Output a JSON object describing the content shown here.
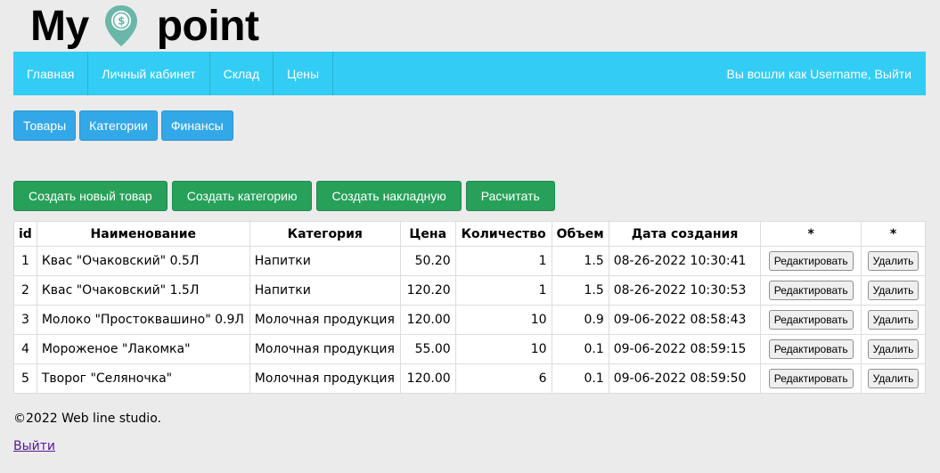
{
  "brand": {
    "word1": "My",
    "word2": "point",
    "pin_symbol": "$",
    "pin_color": "#6ab7a9",
    "icon": "map-pin-dollar-icon"
  },
  "nav": {
    "items": [
      {
        "label": "Главная"
      },
      {
        "label": "Личный кабинет"
      },
      {
        "label": "Склад"
      },
      {
        "label": "Цены"
      }
    ],
    "user_text": "Вы вошли как Username, Выйти"
  },
  "subnav": {
    "items": [
      {
        "label": "Товары"
      },
      {
        "label": "Категории"
      },
      {
        "label": "Финансы"
      }
    ]
  },
  "actions": {
    "create_product": "Создать новый товар",
    "create_category": "Создать категорию",
    "create_invoice": "Создать накладную",
    "calculate": "Расчитать"
  },
  "table": {
    "headers": [
      "id",
      "Наименование",
      "Категория",
      "Цена",
      "Количество",
      "Объем",
      "Дата создания",
      "*",
      "*"
    ],
    "edit_label": "Редактировать",
    "delete_label": "Удалить",
    "rows": [
      {
        "id": "1",
        "name": "Квас \"Очаковский\" 0.5Л",
        "category": "Напитки",
        "price": "50.20",
        "qty": "1",
        "volume": "1.5",
        "created": "08-26-2022 10:30:41"
      },
      {
        "id": "2",
        "name": "Квас \"Очаковский\" 1.5Л",
        "category": "Напитки",
        "price": "120.20",
        "qty": "1",
        "volume": "1.5",
        "created": "08-26-2022 10:30:53"
      },
      {
        "id": "3",
        "name": "Молоко \"Простоквашино\" 0.9Л",
        "category": "Молочная продукция",
        "price": "120.00",
        "qty": "10",
        "volume": "0.9",
        "created": "09-06-2022 08:58:43"
      },
      {
        "id": "4",
        "name": "Мороженое \"Лакомка\"",
        "category": "Молочная продукция",
        "price": "55.00",
        "qty": "10",
        "volume": "0.1",
        "created": "09-06-2022 08:59:15"
      },
      {
        "id": "5",
        "name": "Творог \"Селяночка\"",
        "category": "Молочная продукция",
        "price": "120.00",
        "qty": "6",
        "volume": "0.1",
        "created": "09-06-2022 08:59:50"
      }
    ]
  },
  "footer": {
    "copyright": "©2022 Web line studio.",
    "logout": "Выйти"
  },
  "colors": {
    "nav_bg": "#33ccf4",
    "subnav_btn": "#33a8e8",
    "action_btn": "#27a05a",
    "page_bg": "#ebebeb",
    "link_visited": "#551a8b"
  }
}
